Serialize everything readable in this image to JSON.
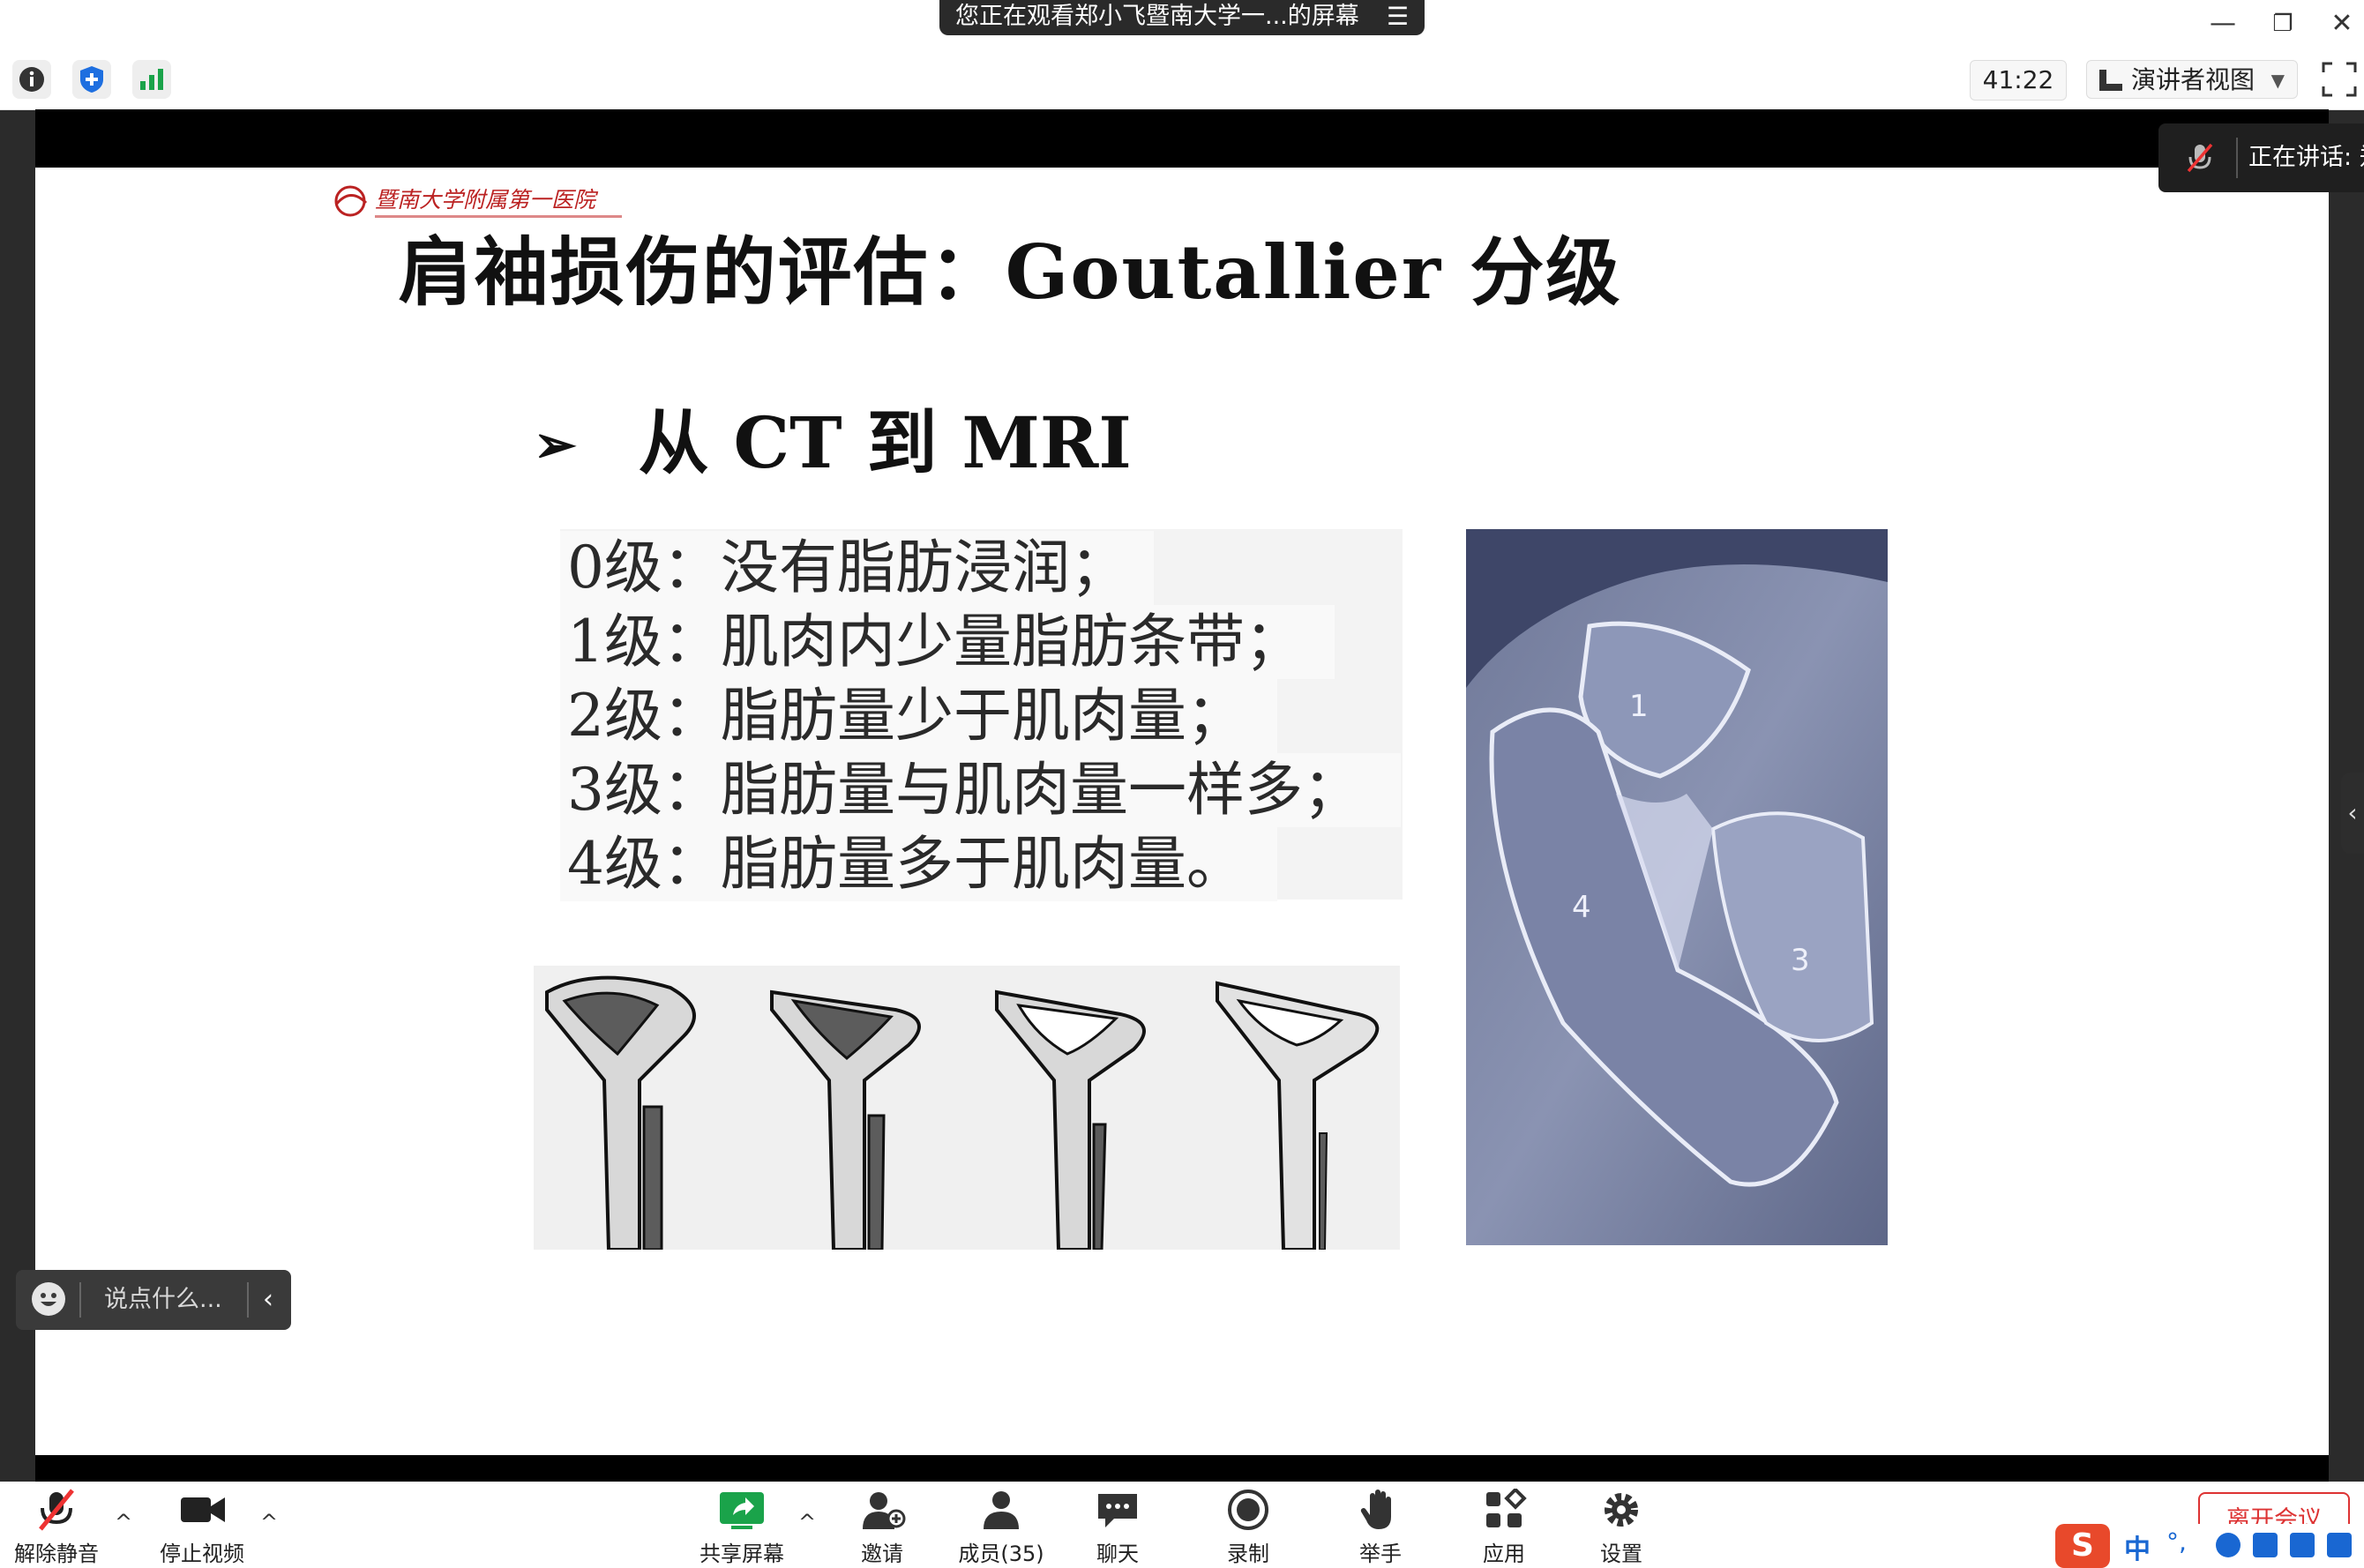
{
  "window": {
    "share_banner": "您正在观看郑小飞暨南大学一...的屏幕",
    "share_menu_glyph": "☰",
    "minimize": "—",
    "restore": "❐",
    "close": "✕"
  },
  "toolbar": {
    "timer": "41:22",
    "view_mode": "演讲者视图",
    "icons": [
      "info-icon",
      "shield-icon",
      "signal-icon",
      "fullscreen-icon"
    ]
  },
  "speaking": {
    "label": "正在讲话: 郑"
  },
  "slide": {
    "logo_text": "暨南大学附属第一医院",
    "title": "肩袖损伤的评估：Goutallier 分级",
    "bullet_arrow": "➢",
    "bullet": "从 CT 到 MRI",
    "grades": [
      "0级：没有脂肪浸润；",
      "1级：肌肉内少量脂肪条带；",
      "2级：脂肪量少于肌肉量；",
      "3级：脂肪量与肌肉量一样多；",
      "4级：脂肪量多于肌肉量。"
    ],
    "mri_labels": [
      "1",
      "4",
      "3"
    ]
  },
  "chat": {
    "placeholder": "说点什么...",
    "chevron": "‹"
  },
  "controls": {
    "unmute": "解除静音",
    "stop_video": "停止视频",
    "share_screen": "共享屏幕",
    "invite": "邀请",
    "participants": "成员(35)",
    "chat": "聊天",
    "record": "录制",
    "raise_hand": "举手",
    "apps": "应用",
    "settings": "设置",
    "leave": "离开会议",
    "caret": "^"
  },
  "ime": {
    "logo": "S",
    "lang": "中",
    "punct": "°,"
  },
  "colors": {
    "accent_green": "#1aa34a",
    "danger": "#dd3333",
    "ime_blue": "#1967d2"
  }
}
